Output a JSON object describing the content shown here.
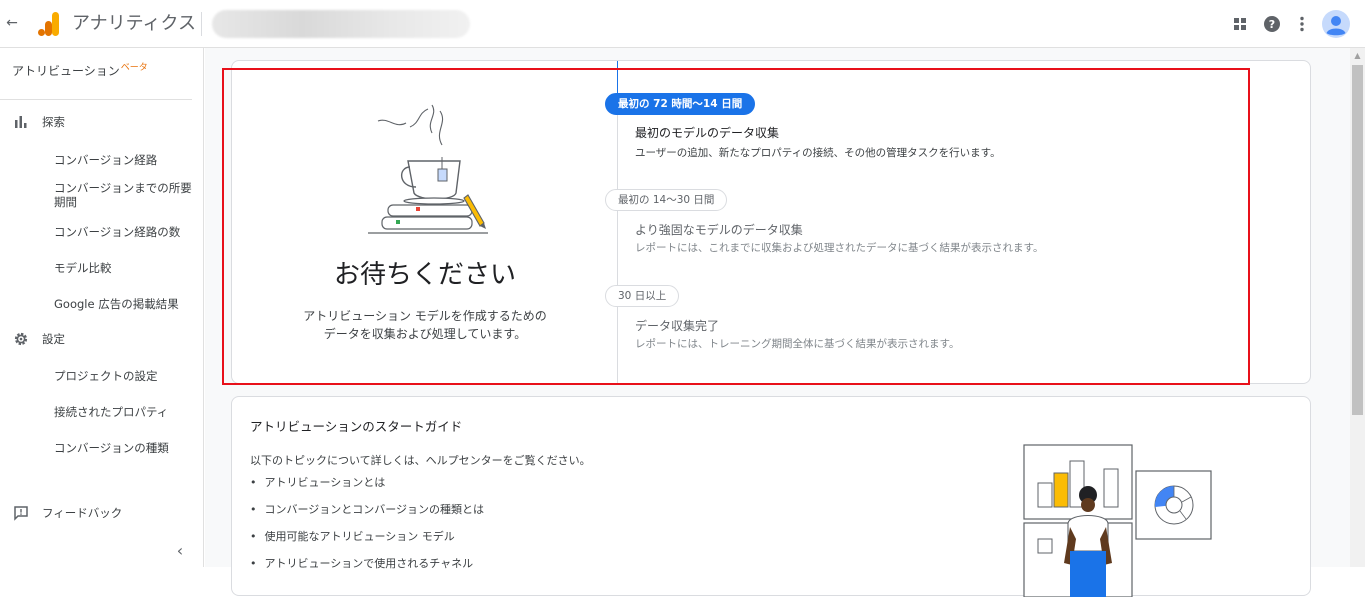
{
  "topbar": {
    "app_title": "アナリティクス"
  },
  "sidebar": {
    "heading": "アトリビューション",
    "heading_badge": "ベータ",
    "sections": [
      {
        "label": "探索",
        "icon": "bar-chart-icon"
      },
      {
        "label": "設定",
        "icon": "gear-icon"
      }
    ],
    "explore_items": [
      {
        "label": "コンバージョン経路"
      },
      {
        "label": "コンバージョンまでの所要期間"
      },
      {
        "label": "コンバージョン経路の数"
      },
      {
        "label": "モデル比較"
      },
      {
        "label": "Google 広告の掲載結果"
      }
    ],
    "settings_items": [
      {
        "label": "プロジェクトの設定"
      },
      {
        "label": "接続されたプロパティ"
      },
      {
        "label": "コンバージョンの種類"
      }
    ],
    "feedback_label": "フィードバック"
  },
  "wait_card": {
    "title": "お待ちください",
    "desc_line1": "アトリビューション モデルを作成するための",
    "desc_line2": "データを収集および処理しています。",
    "steps": [
      {
        "period": "最初の 72 時間〜14 日間",
        "title": "最初のモデルのデータ収集",
        "desc": "ユーザーの追加、新たなプロパティの接続、その他の管理タスクを行います。",
        "active": true
      },
      {
        "period": "最初の 14〜30 日間",
        "title": "より強固なモデルのデータ収集",
        "desc": "レポートには、これまでに収集および処理されたデータに基づく結果が表示されます。",
        "active": false
      },
      {
        "period": "30 日以上",
        "title": "データ収集完了",
        "desc": "レポートには、トレーニング期間全体に基づく結果が表示されます。",
        "active": false
      }
    ]
  },
  "guide_card": {
    "title": "アトリビューションのスタートガイド",
    "intro": "以下のトピックについて詳しくは、ヘルプセンターをご覧ください。",
    "topics": [
      "アトリビューションとは",
      "コンバージョンとコンバージョンの種類とは",
      "使用可能なアトリビューション モデル",
      "アトリビューションで使用されるチャネル"
    ]
  },
  "colors": {
    "accent": "#1a73e8",
    "highlight": "#e8101a",
    "ga_orange": "#f9ab00",
    "ga_dark_orange": "#e37400"
  }
}
